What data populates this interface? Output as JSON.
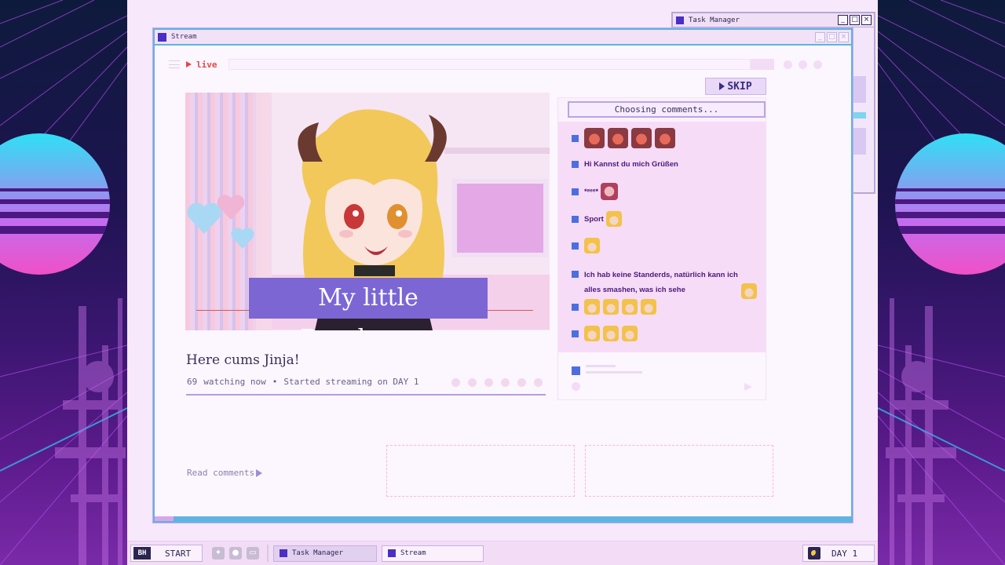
{
  "task_manager_window": {
    "title": "Task Manager"
  },
  "stream_window": {
    "title": "Stream",
    "toolbar": {
      "live_label": "live"
    },
    "video": {
      "caption": "My little Pogchamps"
    },
    "stream_title": "Here cums Jinja!",
    "viewer_count": "69",
    "watching_label": "watching now",
    "separator": "•",
    "started_label": "Started streaming on DAY 1",
    "read_comments_label": "Read comments",
    "skip_label": "SKIP",
    "chat": {
      "header": "Choosing comments...",
      "messages": [
        {
          "text": ""
        },
        {
          "text": "Hi Kannst du mich Grüßen"
        },
        {
          "text": "*ᵉᵉᵉ*"
        },
        {
          "text": "Sport"
        },
        {
          "text": ""
        },
        {
          "text": "Ich hab keine Standerds, natürlich kann ich alles smashen, was ich sehe"
        },
        {
          "text": ""
        },
        {
          "text": ""
        }
      ]
    }
  },
  "taskbar": {
    "start_label": "START",
    "start_logo": "BH",
    "tasks": [
      {
        "label": "Task Manager"
      },
      {
        "label": "Stream"
      }
    ],
    "day_label": "DAY 1"
  },
  "colors": {
    "accent": "#4a2ec6",
    "live_red": "#e04848",
    "caption_bg": "#7b66d4",
    "window_border": "#5fb4e0",
    "chat_bg": "#f7dcf8"
  },
  "icons": [
    "hamburger-icon",
    "play-icon",
    "twitter-icon",
    "chat-bubble-icon",
    "monitor-icon",
    "moon-icon"
  ]
}
